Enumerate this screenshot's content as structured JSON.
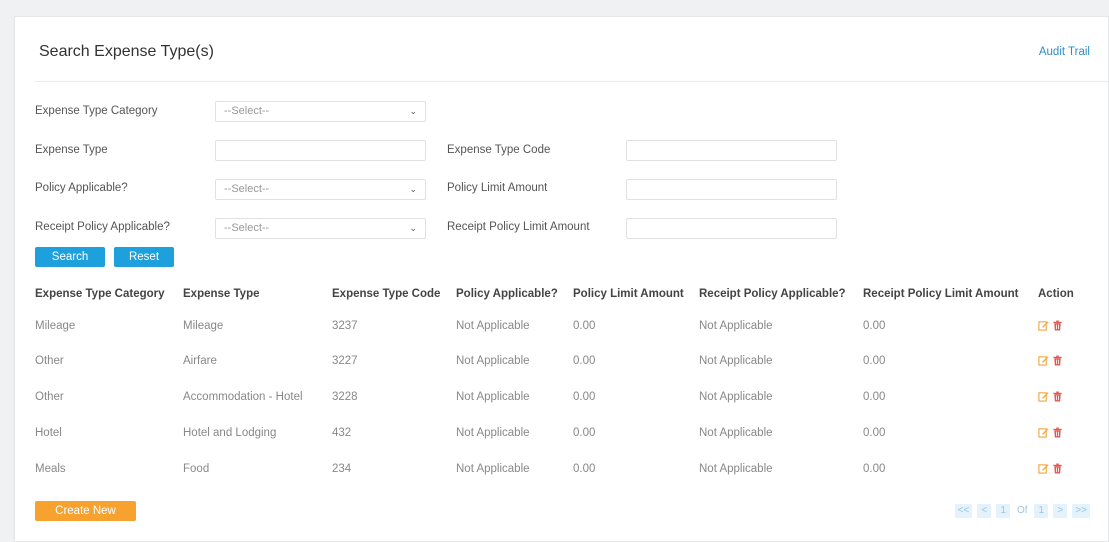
{
  "header": {
    "title": "Search Expense Type(s)",
    "audit_trail": "Audit Trail"
  },
  "form": {
    "expense_type_category": {
      "label": "Expense Type Category",
      "value": "--Select--"
    },
    "expense_type": {
      "label": "Expense Type",
      "value": ""
    },
    "expense_type_code": {
      "label": "Expense Type Code",
      "value": ""
    },
    "policy_applicable": {
      "label": "Policy Applicable?",
      "value": "--Select--"
    },
    "policy_limit_amount": {
      "label": "Policy Limit Amount",
      "value": ""
    },
    "receipt_policy_applicable": {
      "label": "Receipt Policy Applicable?",
      "value": "--Select--"
    },
    "receipt_policy_limit_amount": {
      "label": "Receipt Policy Limit Amount",
      "value": ""
    },
    "search_label": "Search",
    "reset_label": "Reset"
  },
  "table": {
    "columns": [
      "Expense Type Category",
      "Expense Type",
      "Expense Type Code",
      "Policy Applicable?",
      "Policy Limit Amount",
      "Receipt Policy Applicable?",
      "Receipt Policy Limit Amount",
      "Action"
    ],
    "rows": [
      [
        "Mileage",
        "Mileage",
        "3237",
        "Not Applicable",
        "0.00",
        "Not Applicable",
        "0.00"
      ],
      [
        "Other",
        "Airfare",
        "3227",
        "Not Applicable",
        "0.00",
        "Not Applicable",
        "0.00"
      ],
      [
        "Other",
        "Accommodation - Hotel",
        "3228",
        "Not Applicable",
        "0.00",
        "Not Applicable",
        "0.00"
      ],
      [
        "Hotel",
        "Hotel and Lodging",
        "432",
        "Not Applicable",
        "0.00",
        "Not Applicable",
        "0.00"
      ],
      [
        "Meals",
        "Food",
        "234",
        "Not Applicable",
        "0.00",
        "Not Applicable",
        "0.00"
      ]
    ]
  },
  "footer": {
    "create_new_label": "Create New"
  },
  "pagination": {
    "first": "<<",
    "prev": "<",
    "current_page": "1",
    "of_label": "Of",
    "total_pages": "1",
    "next": ">",
    "last": ">>"
  },
  "icons": {
    "edit": "edit-icon",
    "delete": "trash-icon",
    "dropdown": "chevron-down-icon"
  },
  "colors": {
    "primary_blue": "#1ea0dc",
    "create_orange": "#f7a12e",
    "link_blue": "#2a8ec7",
    "edit_icon": "#f2a640",
    "delete_icon": "#e0584f"
  }
}
